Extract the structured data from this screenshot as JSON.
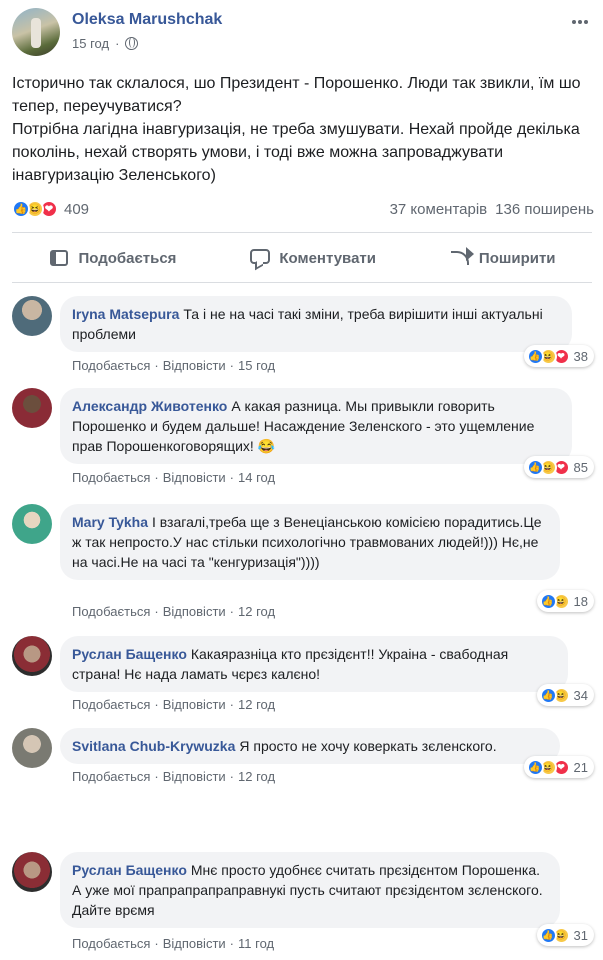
{
  "post": {
    "author": "Oleksa Marushchak",
    "time": "15 год",
    "separator": "·",
    "text_lines": [
      "Історично так склалося, шо Президент - Порошенко. Люди так звикли, їм шо тепер, переучуватися?",
      "Потрібна лагідна інавгуризація, не треба змушувати. Нехай пройде декілька поколінь, нехай створять умови, і тоді вже можна запроваджувати інавгуризацію Зеленського)"
    ],
    "reaction_count": "409",
    "comments_count": "37 коментарів",
    "shares_count": "136 поширень"
  },
  "actions": {
    "like": "Подобається",
    "comment": "Коментувати",
    "share": "Поширити"
  },
  "comments": [
    {
      "name": "Iryna Matsepura",
      "text": "Та і не на часі такі зміни, треба вирішити інші актуальні проблеми",
      "like": "Подобається",
      "reply": "Відповісти",
      "time": "15 год",
      "reactions": "38"
    },
    {
      "name": "Александр Животенко",
      "text": "А какая разница. Мы привыкли говорить Порошенко и будем дальше! Насаждение Зеленского - это ущемление прав Порошенкоговорящих! 😂",
      "like": "Подобається",
      "reply": "Відповісти",
      "time": "14 год",
      "reactions": "85"
    },
    {
      "name": "Mary Tykha",
      "text": "І взагалі,треба ще з Венеціанською комісією порадитись.Це ж так непросто.У нас стільки психологічно травмованих людей!))) Нє,не на часі.Не на часі та \"кенгуризація\"))))",
      "like": "Подобається",
      "reply": "Відповісти",
      "time": "12 год",
      "reactions": "18"
    },
    {
      "name": "Руслан Бащенко",
      "text": "Какаяразніца кто прєзідєнт!! Украіна - свабодная страна! Нє нада ламать чєрєз калєно!",
      "like": "Подобається",
      "reply": "Відповісти",
      "time": "12 год",
      "reactions": "34"
    },
    {
      "name": "Svitlana Chub-Krywuzka",
      "text": "Я просто не хочу коверкать зєленского.",
      "like": "Подобається",
      "reply": "Відповісти",
      "time": "12 год",
      "reactions": "21"
    },
    {
      "name": "Руслан Бащенко",
      "text": "Мнє просто удобнєє считать прєзідєнтом Порошенка. А уже мої прапрапрапраправнукі пусть считают прєзідєнтом зєленского. Дайте врємя",
      "like": "Подобається",
      "reply": "Відповісти",
      "time": "11 год",
      "reactions": "31"
    }
  ]
}
